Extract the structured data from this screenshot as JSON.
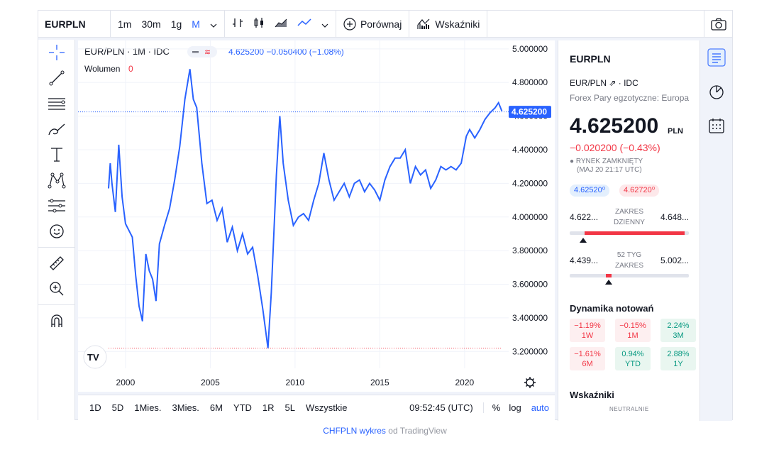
{
  "topbar": {
    "symbol": "EURPLN",
    "timeframes": [
      "1m",
      "30m",
      "1g",
      "M"
    ],
    "compare": "Porównaj",
    "indicators": "Wskaźniki"
  },
  "legend": {
    "pair": "EUR/PLN · 1M · IDC",
    "quote": "4.625200 −0.050400 (−1.08%)",
    "volume_label": "Wolumen",
    "volume_value": "0"
  },
  "price_tag": "4.625200",
  "bottombar": {
    "ranges": [
      "1D",
      "5D",
      "1Mies.",
      "3Mies.",
      "6M",
      "YTD",
      "1R",
      "5L",
      "Wszystkie"
    ],
    "time": "09:52:45 (UTC)",
    "pct": "%",
    "log": "log",
    "auto": "auto"
  },
  "panel": {
    "title": "EURPLN",
    "exchange": "EUR/PLN ⇗ · IDC",
    "description": "Forex Pary egzotyczne: Europa",
    "price": "4.625200",
    "currency": "PLN",
    "change": "−0.020200 (−0.43%)",
    "status_line1": "RYNEK ZAMKNIĘTY",
    "status_line2": "(MAJ 20 21:17 UTC)",
    "bid": "4.62520⁰",
    "ask": "4.62720⁰",
    "day_low": "4.622...",
    "day_high": "4.648...",
    "day_label1": "ZAKRES",
    "day_label2": "DZIENNY",
    "day_fill": 0.9,
    "w52_low": "4.439...",
    "w52_high": "5.002...",
    "w52_label1": "52 TYG",
    "w52_label2": "ZAKRES",
    "w52_position": 0.33,
    "perf_title": "Dynamika notowań",
    "perf": [
      {
        "v": "−1.19%",
        "l": "1W",
        "sign": "neg"
      },
      {
        "v": "−0.15%",
        "l": "1M",
        "sign": "neg"
      },
      {
        "v": "2.24%",
        "l": "3M",
        "sign": "pos"
      },
      {
        "v": "−1.61%",
        "l": "6M",
        "sign": "neg"
      },
      {
        "v": "0.94%",
        "l": "YTD",
        "sign": "pos"
      },
      {
        "v": "2.88%",
        "l": "1Y",
        "sign": "pos"
      }
    ],
    "tech_title": "Wskaźniki",
    "tech_state": "NEUTRALNIE"
  },
  "caption": {
    "link": "CHFPLN wykres",
    "rest": "od TradingView"
  },
  "chart_data": {
    "type": "line",
    "ylim": [
      3.1,
      5.05
    ],
    "xlim": [
      1997.2,
      2022.6
    ],
    "yticks": [
      "5.000000",
      "4.800000",
      "4.600000",
      "4.400000",
      "4.200000",
      "4.000000",
      "3.800000",
      "3.600000",
      "3.400000",
      "3.200000"
    ],
    "xticks": [
      "2000",
      "2005",
      "2010",
      "2015",
      "2020"
    ],
    "series": [
      {
        "color": "#2962ff",
        "x": [
          1999.0,
          1999.1,
          1999.2,
          1999.4,
          1999.6,
          1999.8,
          2000.0,
          2000.2,
          2000.4,
          2000.6,
          2000.8,
          2001.0,
          2001.2,
          2001.4,
          2001.6,
          2001.8,
          2002.0,
          2002.3,
          2002.6,
          2002.9,
          2003.2,
          2003.5,
          2003.8,
          2004.0,
          2004.2,
          2004.5,
          2004.8,
          2005.1,
          2005.4,
          2005.7,
          2006.0,
          2006.3,
          2006.6,
          2006.9,
          2007.2,
          2007.5,
          2007.8,
          2008.1,
          2008.4,
          2008.6,
          2008.9,
          2009.1,
          2009.3,
          2009.6,
          2009.9,
          2010.2,
          2010.5,
          2010.8,
          2011.1,
          2011.4,
          2011.7,
          2012.0,
          2012.3,
          2012.6,
          2012.9,
          2013.2,
          2013.5,
          2013.8,
          2014.1,
          2014.4,
          2014.7,
          2015.0,
          2015.3,
          2015.6,
          2015.9,
          2016.2,
          2016.5,
          2016.8,
          2017.1,
          2017.4,
          2017.7,
          2018.0,
          2018.3,
          2018.6,
          2018.9,
          2019.2,
          2019.5,
          2019.8,
          2020.1,
          2020.3,
          2020.6,
          2020.9,
          2021.2,
          2021.5,
          2021.8,
          2022.0,
          2022.2
        ],
        "y": [
          4.17,
          4.32,
          4.2,
          4.03,
          4.43,
          4.12,
          3.96,
          3.92,
          3.88,
          3.65,
          3.47,
          3.38,
          3.78,
          3.68,
          3.63,
          3.5,
          3.84,
          3.95,
          4.05,
          4.22,
          4.42,
          4.7,
          4.88,
          4.7,
          4.65,
          4.32,
          4.08,
          4.1,
          3.98,
          4.05,
          3.85,
          3.94,
          3.8,
          3.9,
          3.78,
          3.82,
          3.65,
          3.45,
          3.22,
          3.55,
          4.25,
          4.6,
          4.32,
          4.1,
          3.95,
          4.0,
          4.02,
          3.98,
          4.1,
          4.2,
          4.38,
          4.22,
          4.1,
          4.15,
          4.2,
          4.12,
          4.2,
          4.22,
          4.15,
          4.2,
          4.16,
          4.1,
          4.22,
          4.3,
          4.35,
          4.35,
          4.4,
          4.2,
          4.3,
          4.25,
          4.28,
          4.17,
          4.22,
          4.3,
          4.28,
          4.3,
          4.28,
          4.32,
          4.48,
          4.52,
          4.47,
          4.52,
          4.58,
          4.62,
          4.65,
          4.68,
          4.63
        ]
      }
    ]
  }
}
